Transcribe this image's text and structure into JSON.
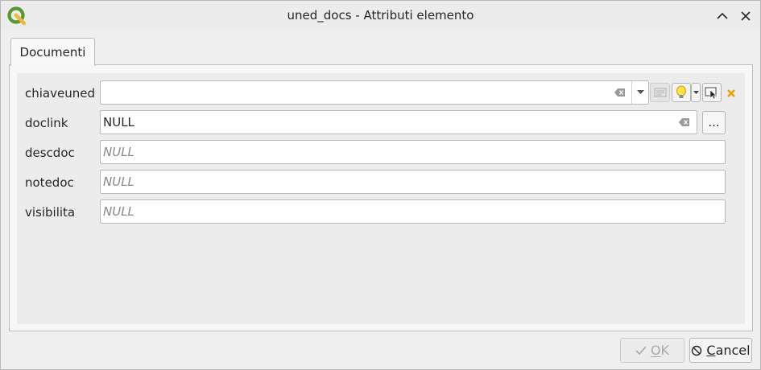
{
  "window": {
    "title": "uned_docs - Attributi elemento",
    "icons": {
      "app": "qgis-logo-icon",
      "minimize": "chevron-up-icon",
      "close": "close-icon"
    }
  },
  "tabs": [
    {
      "label": "Documenti",
      "active": true
    }
  ],
  "fields": [
    {
      "name": "chiaveuned",
      "value": "",
      "widget": "combo-relation"
    },
    {
      "name": "doclink",
      "value": "NULL",
      "widget": "file-link"
    },
    {
      "name": "descdoc",
      "value": "NULL",
      "widget": "text"
    },
    {
      "name": "notedoc",
      "value": "NULL",
      "widget": "text"
    },
    {
      "name": "visibilita",
      "value": "NULL",
      "widget": "text"
    }
  ],
  "relation_tools": {
    "icons": [
      "form-icon",
      "lightbulb-icon",
      "dropdown-arrow-icon",
      "identify-cursor-icon",
      "remove-x-icon"
    ]
  },
  "doclink_button": "...",
  "buttons": {
    "ok": {
      "label": "OK",
      "mnemonic": "O",
      "enabled": false,
      "icon": "check-icon"
    },
    "cancel": {
      "label": "Cancel",
      "mnemonic": "C",
      "enabled": true,
      "icon": "cancel-circle-icon"
    }
  },
  "colors": {
    "accent": "#f0a000",
    "qgis_green": "#589632",
    "qgis_yellow": "#eeb83a"
  }
}
